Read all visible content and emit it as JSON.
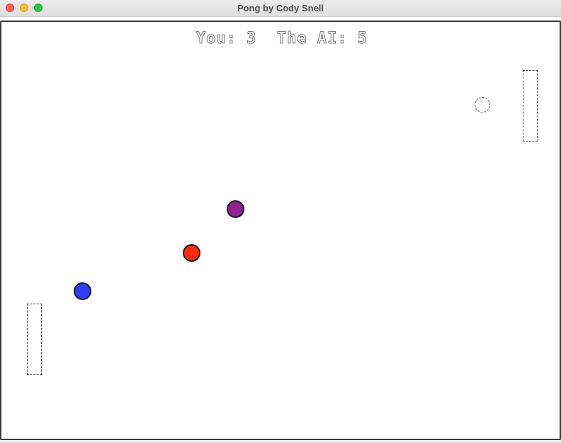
{
  "window": {
    "title": "Pong by Cody Snell"
  },
  "scoreboard": {
    "text": "You: 3  The AI: 5",
    "player_label": "You",
    "player_score": 3,
    "ai_label": "The AI",
    "ai_score": 5
  },
  "balls": {
    "purple": {
      "color": "#8e2593"
    },
    "red": {
      "color": "#ff2b0d"
    },
    "blue": {
      "color": "#2f3ef7"
    }
  }
}
